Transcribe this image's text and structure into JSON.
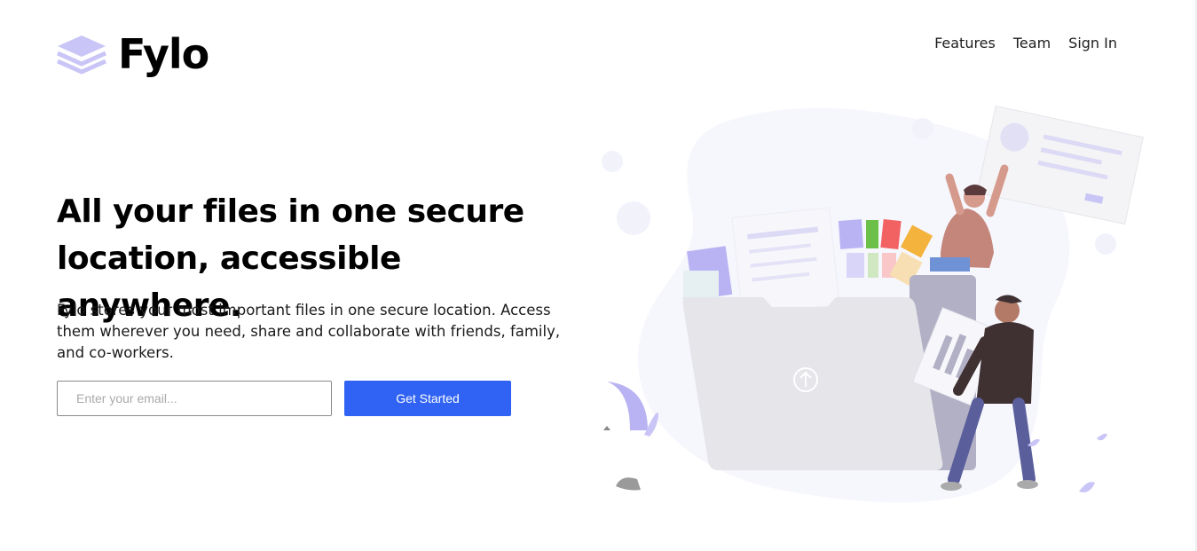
{
  "brand": {
    "name": "Fylo",
    "logo_icon": "layers-stack-icon",
    "accent_color": "#b9b3f3"
  },
  "nav": {
    "items": [
      {
        "label": "Features"
      },
      {
        "label": "Team"
      },
      {
        "label": "Sign In"
      }
    ]
  },
  "hero": {
    "title_line_1": "All your files in one secure",
    "title_line_2": "location, accessible anywhere.",
    "description": "Fylo stores your most important files in one secure location. Access them wherever you need, share and collaborate with friends, family, and co-workers.",
    "illustration_icon": "file-sharing-illustration"
  },
  "signup": {
    "email_placeholder": "Enter your email...",
    "email_value": "",
    "button_label": "Get Started",
    "button_color": "#3063f3"
  }
}
